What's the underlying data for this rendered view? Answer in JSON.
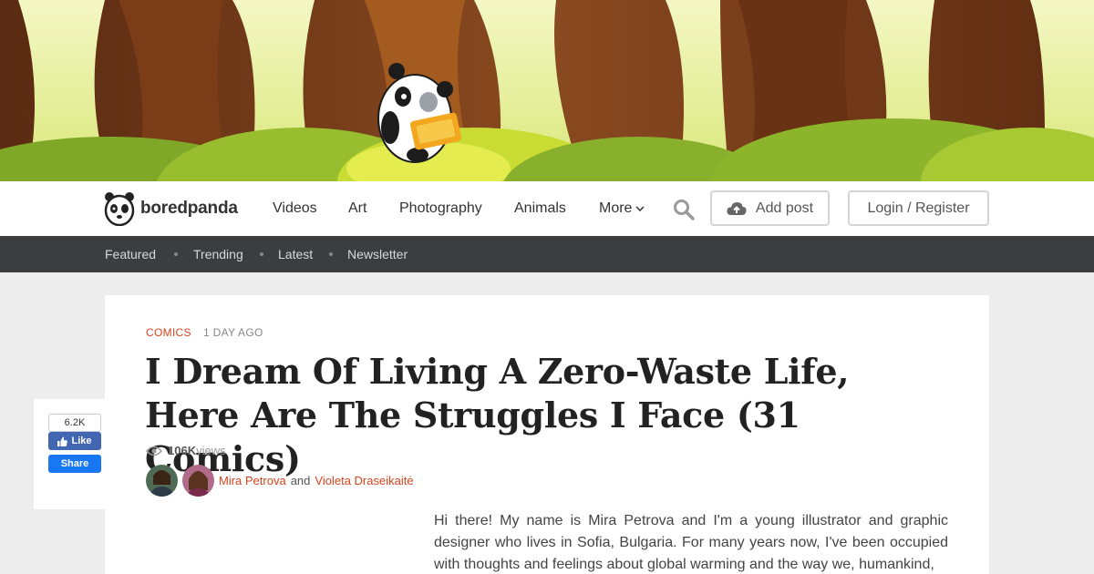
{
  "header": {
    "logo_text": "boredpanda",
    "nav": [
      "Videos",
      "Art",
      "Photography",
      "Animals",
      "More"
    ],
    "add_post": "Add post",
    "login": "Login / Register"
  },
  "subnav": [
    "Featured",
    "Trending",
    "Latest",
    "Newsletter"
  ],
  "article": {
    "category": "COMICS",
    "posted_ago": "1 DAY AGO",
    "title": "I Dream Of Living A Zero-Waste Life, Here Are The Struggles I Face (31 Comics)",
    "views_count": "106K",
    "views_label": "views",
    "author1": "Mira Petrova",
    "author_joiner": "and",
    "author2": "Violeta Draseikaitė",
    "intro": "Hi there! My name is Mira Petrova and I'm a young illustrator and graphic designer who lives in Sofia, Bulgaria. For many years now, I've been occupied with thoughts and feelings about global warming and the way we, humankind,"
  },
  "share": {
    "like_count": "6.2K",
    "like_label": "Like",
    "share_label": "Share"
  },
  "colors": {
    "accent": "#d9431e",
    "subnav_bg": "#3b3d3f",
    "facebook": "#4267b2"
  },
  "icons": [
    "panda-logo-icon",
    "search-icon",
    "cloud-upload-icon",
    "chevron-down-icon",
    "eye-icon",
    "thumbs-up-icon"
  ]
}
